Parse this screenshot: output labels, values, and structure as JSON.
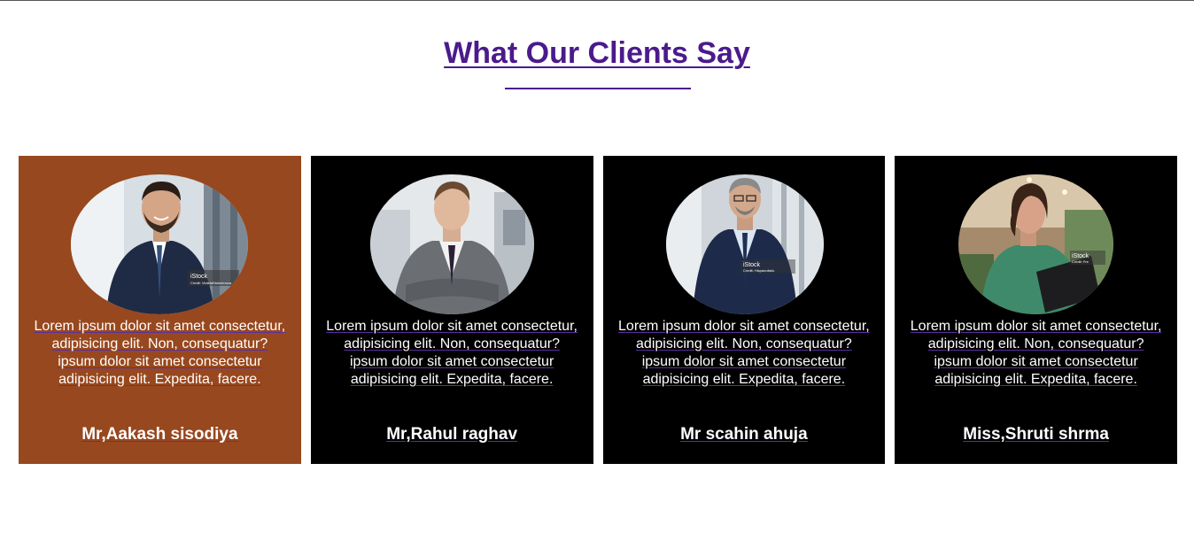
{
  "section": {
    "title": "What Our Clients Say"
  },
  "colors": {
    "title": "#4b1a8c",
    "card_active": "#98481e",
    "card_default": "#000000",
    "card_text": "#ffffff"
  },
  "testimonials": [
    {
      "quote": "Lorem ipsum dolor sit amet consectetur, adipisicing elit. Non, consequatur? ipsum dolor sit amet consectetur adipisicing elit. Expedita, facere.",
      "name": "Mr,Aakash sisodiya",
      "photo": "smiling-man-in-navy-suit-photo",
      "active": true
    },
    {
      "quote": "Lorem ipsum dolor sit amet consectetur, adipisicing elit. Non, consequatur? ipsum dolor sit amet consectetur adipisicing elit. Expedita, facere.",
      "name": "Mr,Rahul raghav",
      "photo": "young-man-in-grey-suit-arms-crossed-photo",
      "active": false
    },
    {
      "quote": "Lorem ipsum dolor sit amet consectetur, adipisicing elit. Non, consequatur? ipsum dolor sit amet consectetur adipisicing elit. Expedita, facere.",
      "name": "Mr scahin ahuja",
      "photo": "man-with-glasses-in-navy-suit-photo",
      "active": false
    },
    {
      "quote": "Lorem ipsum dolor sit amet consectetur, adipisicing elit. Non, consequatur? ipsum dolor sit amet consectetur adipisicing elit. Expedita, facere.",
      "name": "Miss,Shruti shrma",
      "photo": "woman-holding-tablet-photo",
      "active": false
    }
  ]
}
